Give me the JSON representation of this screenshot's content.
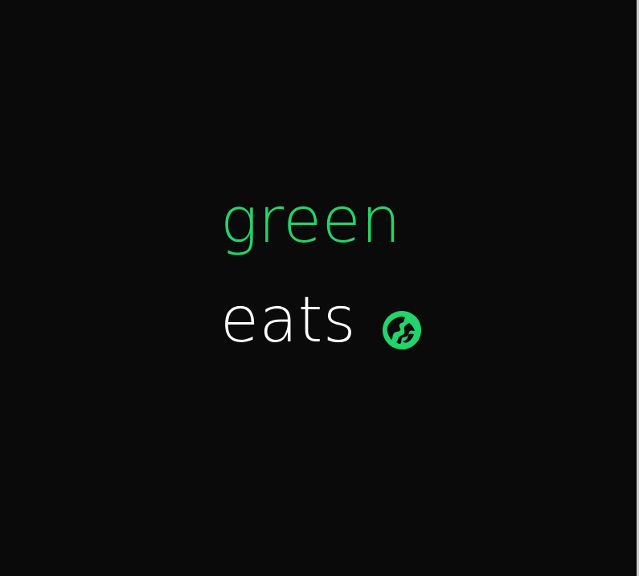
{
  "brand": {
    "word_top": "green",
    "word_bottom": "eats",
    "icon": "globe-icon"
  },
  "colors": {
    "accent": "#22d46c",
    "text_primary": "#ffffff",
    "background": "#0a0a0a"
  }
}
